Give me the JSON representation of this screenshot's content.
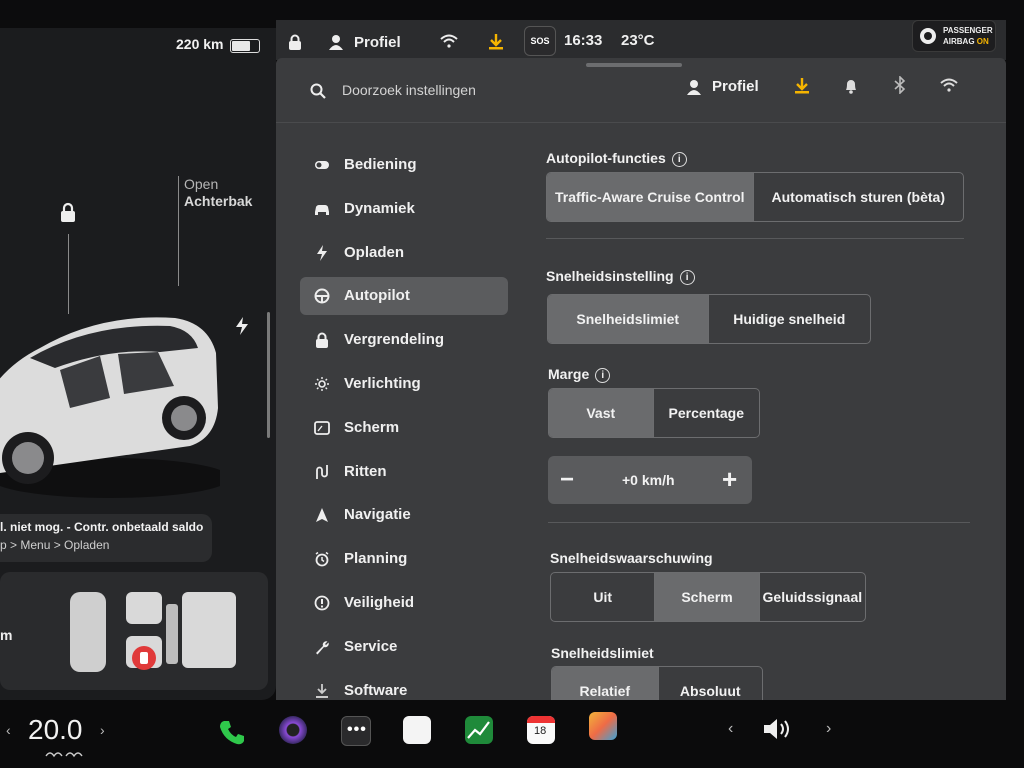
{
  "status": {
    "range": "220 km",
    "profile": "Profiel",
    "sos": "SOS",
    "time": "16:33",
    "temperature": "23°C",
    "airbag": {
      "line1": "PASSENGER",
      "line2": "AIRBAG",
      "state": "ON"
    }
  },
  "car": {
    "trunk_state": "Open",
    "trunk_name": "Achterbak",
    "notice_line1": "l. niet mog. - Contr. onbetaald saldo",
    "notice_line2": "p > Menu > Opladen",
    "seat_partial": "m"
  },
  "settings_header": {
    "search_placeholder": "Doorzoek instellingen",
    "profile": "Profiel"
  },
  "nav": [
    {
      "label": "Bediening",
      "icon": "toggle-icon"
    },
    {
      "label": "Dynamiek",
      "icon": "car-icon"
    },
    {
      "label": "Opladen",
      "icon": "bolt-icon"
    },
    {
      "label": "Autopilot",
      "icon": "steering-wheel-icon",
      "active": true
    },
    {
      "label": "Vergrendeling",
      "icon": "lock-icon"
    },
    {
      "label": "Verlichting",
      "icon": "sun-icon"
    },
    {
      "label": "Scherm",
      "icon": "display-icon"
    },
    {
      "label": "Ritten",
      "icon": "trips-icon"
    },
    {
      "label": "Navigatie",
      "icon": "navigation-arrow-icon"
    },
    {
      "label": "Planning",
      "icon": "alarm-clock-icon"
    },
    {
      "label": "Veiligheid",
      "icon": "alert-circle-icon"
    },
    {
      "label": "Service",
      "icon": "wrench-icon"
    },
    {
      "label": "Software",
      "icon": "download-icon"
    }
  ],
  "autopilot": {
    "functions_title": "Autopilot-functies",
    "functions_options": [
      "Traffic-Aware Cruise Control",
      "Automatisch sturen (bèta)"
    ],
    "functions_selected": 0,
    "speed_setting_title": "Snelheidsinstelling",
    "speed_setting_options": [
      "Snelheidslimiet",
      "Huidige snelheid"
    ],
    "speed_setting_selected": 0,
    "margin_title": "Marge",
    "margin_options": [
      "Vast",
      "Percentage"
    ],
    "margin_selected": 0,
    "offset_value": "+0 km/h",
    "warning_title": "Snelheidswaarschuwing",
    "warning_options": [
      "Uit",
      "Scherm",
      "Geluidssignaal"
    ],
    "warning_selected": 1,
    "limit_title": "Snelheidslimiet",
    "limit_options": [
      "Relatief",
      "Absoluut"
    ],
    "limit_selected": 0
  },
  "dock": {
    "cabin_temp": "20.0",
    "calendar_day": "18"
  },
  "colors": {
    "accent_yellow": "#f5b400",
    "phone_green": "#2fc84b"
  }
}
